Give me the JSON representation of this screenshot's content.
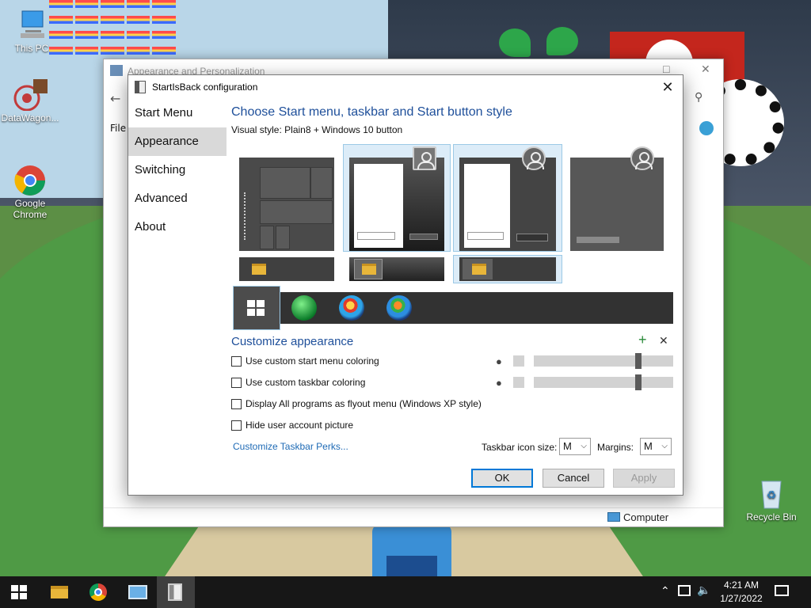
{
  "desktop": {
    "icons": [
      {
        "label": "This PC"
      },
      {
        "label": "DataWagon..."
      },
      {
        "label": "Google Chrome"
      },
      {
        "label": "Recycle Bin"
      }
    ]
  },
  "background_window": {
    "title": "Appearance and Personalization",
    "menu_file": "File",
    "status_computer": "Computer"
  },
  "dialog": {
    "title": "StartIsBack configuration",
    "close_glyph": "✕",
    "nav": [
      "Start Menu",
      "Appearance",
      "Switching",
      "Advanced",
      "About"
    ],
    "selected_nav": "Appearance",
    "heading": "Choose Start menu, taskbar and Start button style",
    "visual_style": "Visual style:  Plain8 + Windows 10 button",
    "customize_heading": "Customize appearance",
    "add_glyph": "+",
    "remove_glyph": "✕",
    "options": [
      {
        "label": "Use custom start menu coloring",
        "checked": false
      },
      {
        "label": "Use custom taskbar coloring",
        "checked": false
      },
      {
        "label": "Display All programs as flyout menu (Windows XP style)",
        "checked": false
      },
      {
        "label": "Hide user account picture",
        "checked": false
      }
    ],
    "perks_link": "Customize Taskbar Perks...",
    "icon_size_label": "Taskbar icon size:",
    "icon_size_value": "M",
    "margins_label": "Margins:",
    "margins_value": "M",
    "buttons": {
      "ok": "OK",
      "cancel": "Cancel",
      "apply": "Apply"
    }
  },
  "taskbar": {
    "time": "4:21 AM",
    "date": "1/27/2022"
  },
  "colors": {
    "accent": "#0078d7",
    "heading_blue": "#1e4f9a",
    "taskbar": "#171717"
  }
}
